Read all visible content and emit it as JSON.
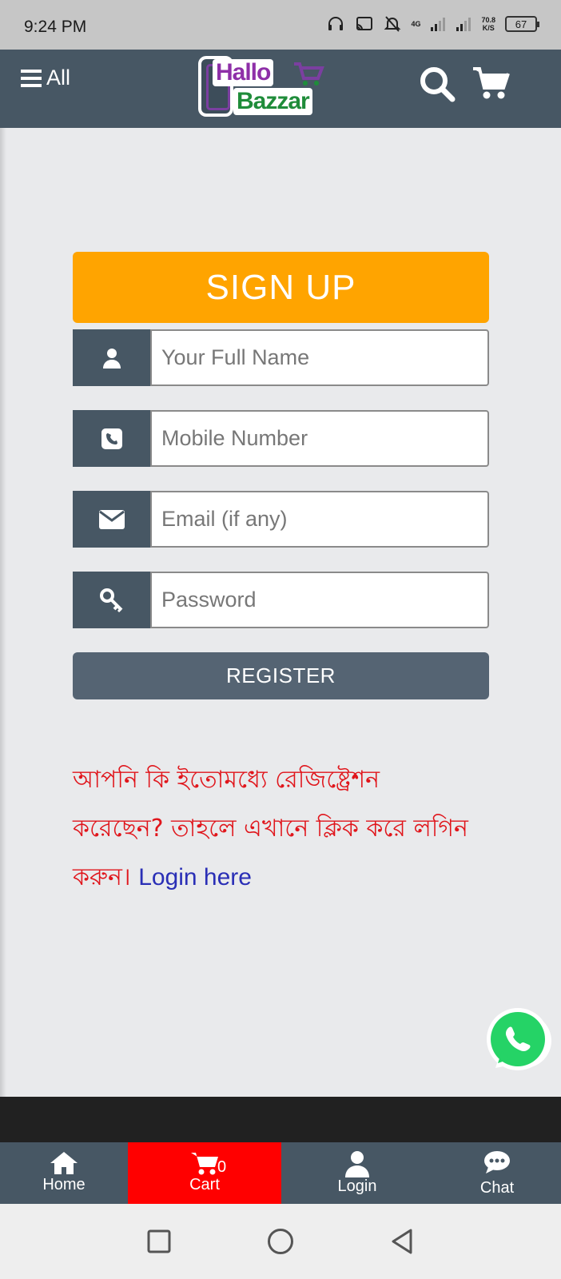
{
  "status_bar": {
    "time": "9:24 PM",
    "net_type": "4G",
    "speed_value": "70.8",
    "speed_unit": "K/S",
    "battery": "67"
  },
  "header": {
    "menu_label": "All",
    "logo_line1": "Hallo",
    "logo_line2": "Bazzar"
  },
  "form": {
    "title": "SIGN UP",
    "full_name_placeholder": "Your Full Name",
    "mobile_placeholder": "Mobile Number",
    "email_placeholder": "Email (if any)",
    "password_placeholder": "Password",
    "register_label": "REGISTER"
  },
  "login_note": {
    "text": "আপনি কি ইতোমধ্যে রেজিষ্ট্রেশন করেছেন? তাহলে এখানে ক্লিক করে লগিন করুন। ",
    "link": "Login here"
  },
  "bottom_nav": {
    "home": "Home",
    "cart": "Cart",
    "cart_count": "0",
    "login": "Login",
    "chat": "Chat"
  },
  "colors": {
    "header_bg": "#475764",
    "signup_orange": "#ffa400",
    "cart_red": "#ff0000",
    "note_red": "#e0151b",
    "link_blue": "#2a2fb6"
  }
}
